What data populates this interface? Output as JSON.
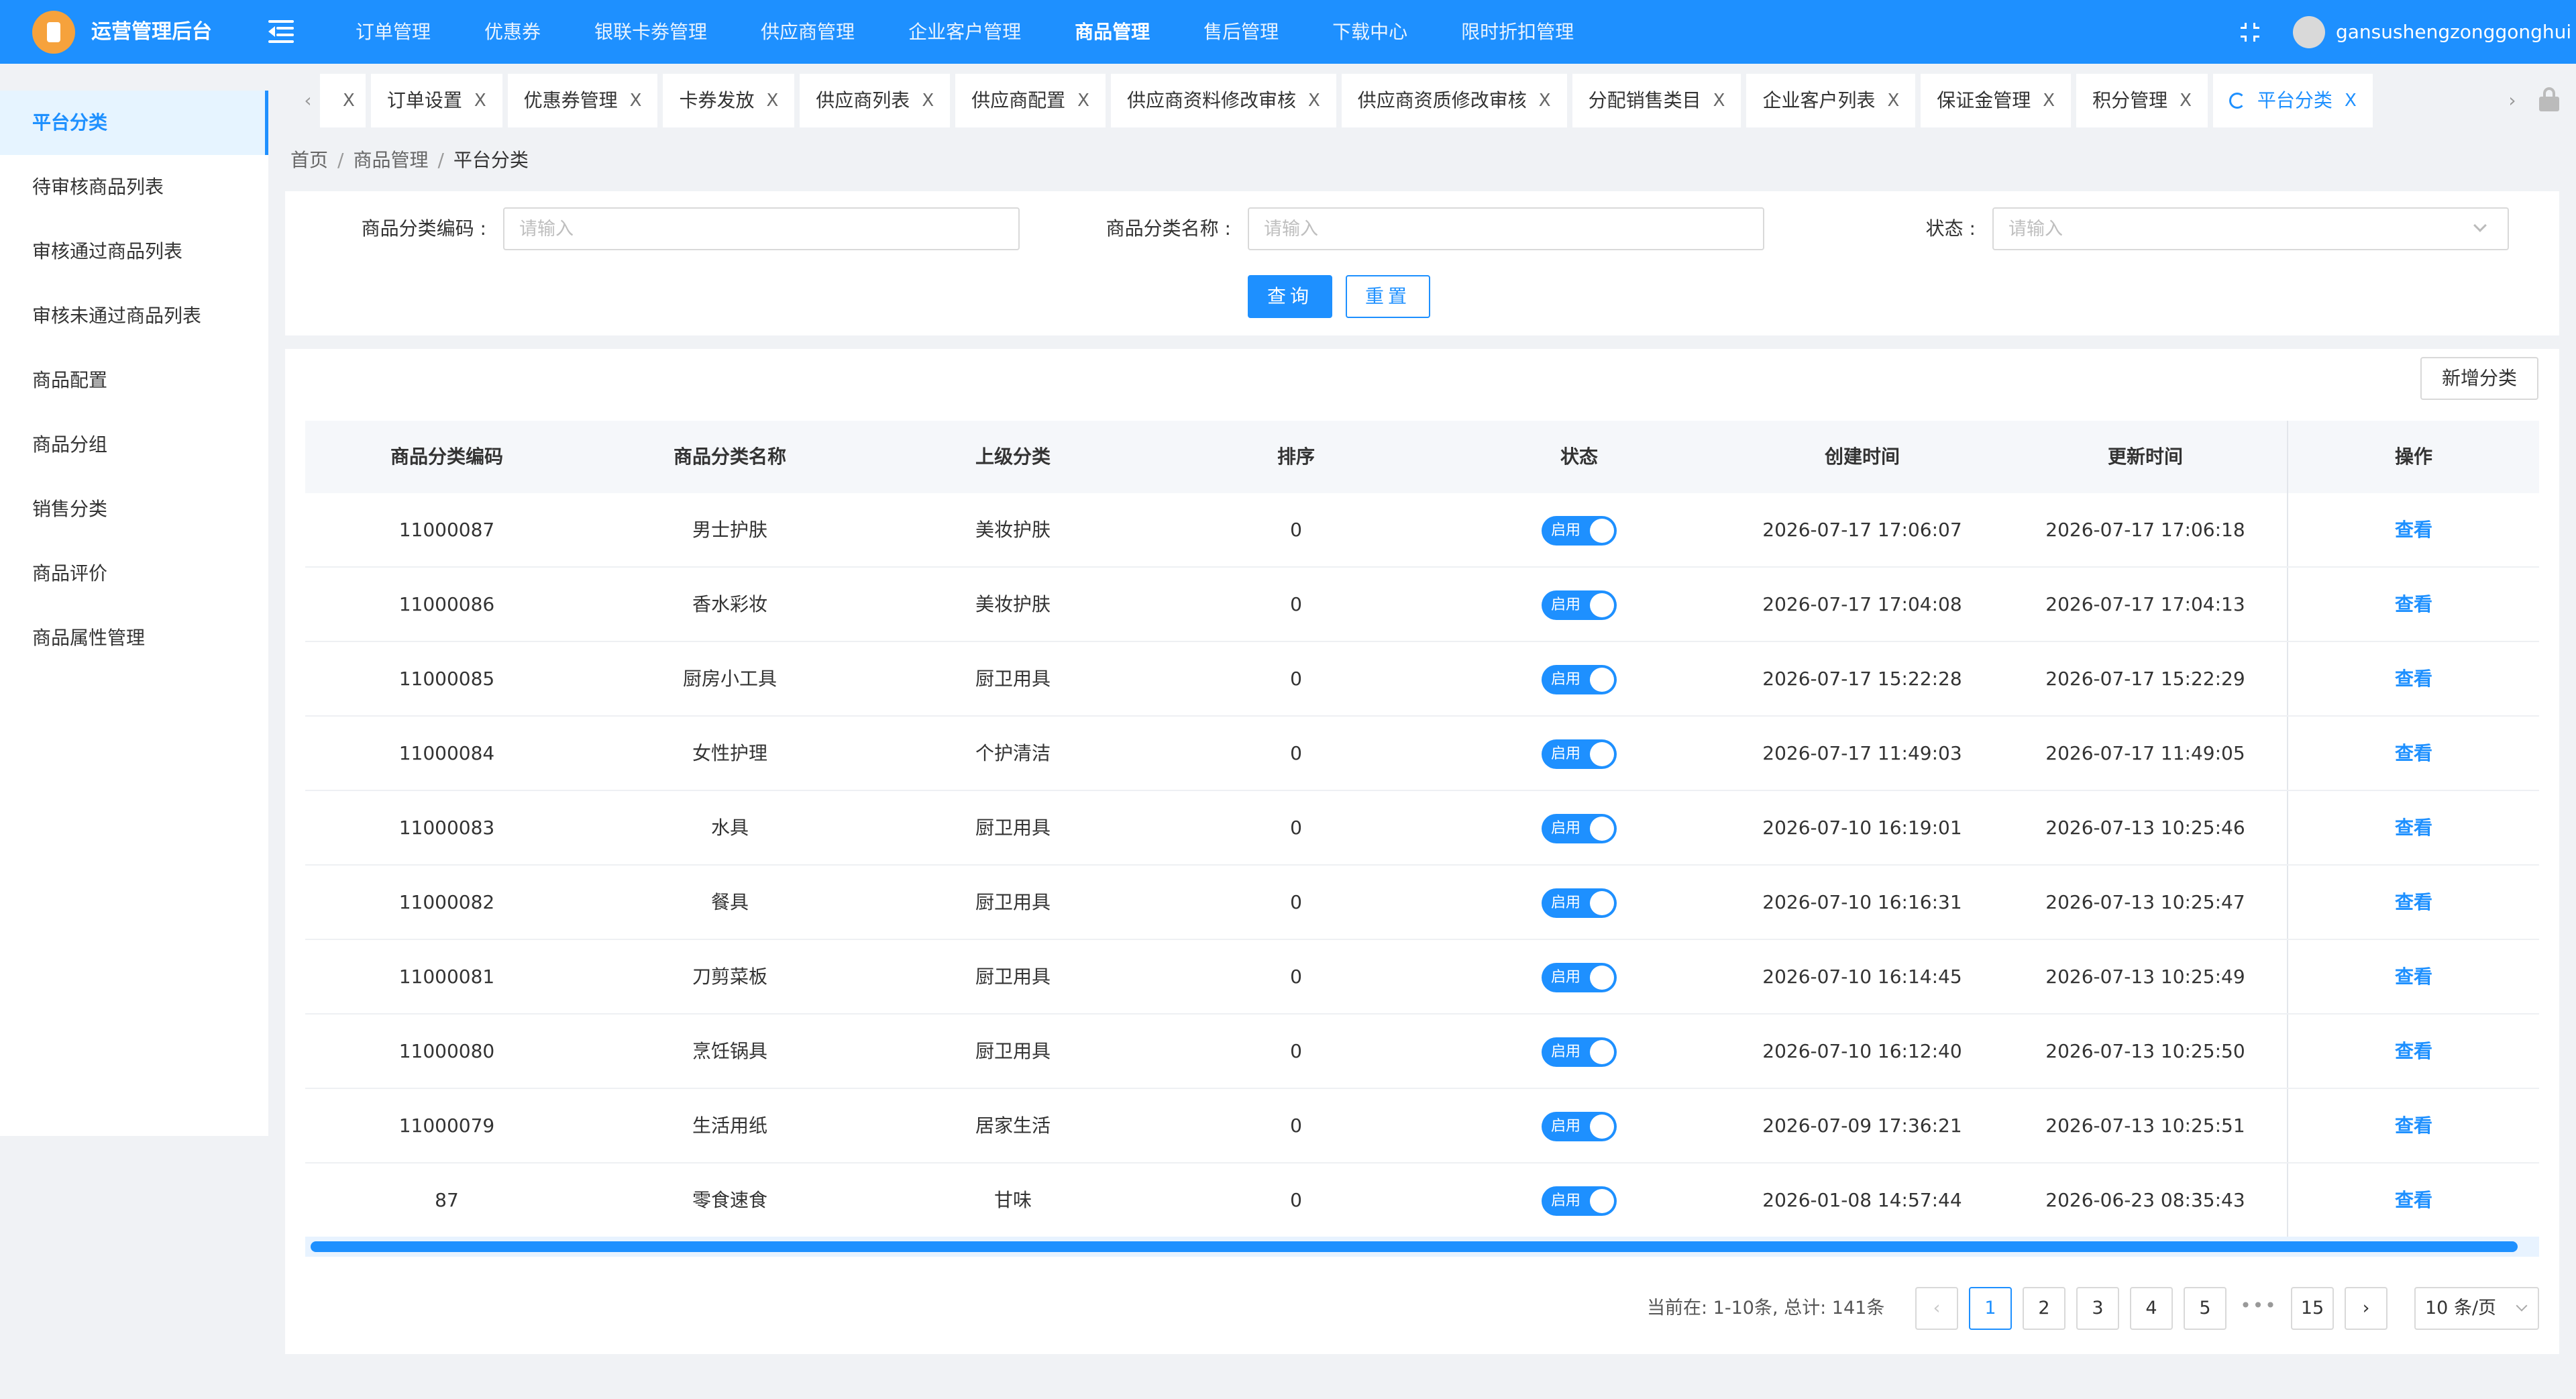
{
  "app": {
    "title": "运营管理后台",
    "username": "gansushengzonggonghui"
  },
  "top_nav": [
    "订单管理",
    "优惠券",
    "银联卡劵管理",
    "供应商管理",
    "企业客户管理",
    "商品管理",
    "售后管理",
    "下载中心",
    "限时折扣管理"
  ],
  "sidebar": [
    "平台分类",
    "待审核商品列表",
    "审核通过商品列表",
    "审核未通过商品列表",
    "商品配置",
    "商品分组",
    "销售分类",
    "商品评价",
    "商品属性管理"
  ],
  "tabs": [
    "订单设置",
    "优惠券管理",
    "卡券发放",
    "供应商列表",
    "供应商配置",
    "供应商资料修改审核",
    "供应商资质修改审核",
    "分配销售类目",
    "企业客户列表",
    "保证金管理",
    "积分管理",
    "平台分类"
  ],
  "tab_close": "X",
  "breadcrumb": [
    "首页",
    "商品管理",
    "平台分类"
  ],
  "breadcrumb_sep": "/",
  "search": {
    "code_label": "商品分类编码 :",
    "name_label": "商品分类名称 :",
    "status_label": "状态 :",
    "placeholder": "请输入",
    "query_button": "查询",
    "reset_button": "重置"
  },
  "add_button": "新增分类",
  "table": {
    "headers": [
      "商品分类编码",
      "商品分类名称",
      "上级分类",
      "排序",
      "状态",
      "创建时间",
      "更新时间",
      "操作"
    ],
    "rows": [
      {
        "code": "11000087",
        "name": "男士护肤",
        "parent": "美妆护肤",
        "sort": "0",
        "status": "启用",
        "created": "2026-07-17 17:06:07",
        "updated": "2026-07-17 17:06:18",
        "action": "查看"
      },
      {
        "code": "11000086",
        "name": "香水彩妆",
        "parent": "美妆护肤",
        "sort": "0",
        "status": "启用",
        "created": "2026-07-17 17:04:08",
        "updated": "2026-07-17 17:04:13",
        "action": "查看"
      },
      {
        "code": "11000085",
        "name": "厨房小工具",
        "parent": "厨卫用具",
        "sort": "0",
        "status": "启用",
        "created": "2026-07-17 15:22:28",
        "updated": "2026-07-17 15:22:29",
        "action": "查看"
      },
      {
        "code": "11000084",
        "name": "女性护理",
        "parent": "个护清洁",
        "sort": "0",
        "status": "启用",
        "created": "2026-07-17 11:49:03",
        "updated": "2026-07-17 11:49:05",
        "action": "查看"
      },
      {
        "code": "11000083",
        "name": "水具",
        "parent": "厨卫用具",
        "sort": "0",
        "status": "启用",
        "created": "2026-07-10 16:19:01",
        "updated": "2026-07-13 10:25:46",
        "action": "查看"
      },
      {
        "code": "11000082",
        "name": "餐具",
        "parent": "厨卫用具",
        "sort": "0",
        "status": "启用",
        "created": "2026-07-10 16:16:31",
        "updated": "2026-07-13 10:25:47",
        "action": "查看"
      },
      {
        "code": "11000081",
        "name": "刀剪菜板",
        "parent": "厨卫用具",
        "sort": "0",
        "status": "启用",
        "created": "2026-07-10 16:14:45",
        "updated": "2026-07-13 10:25:49",
        "action": "查看"
      },
      {
        "code": "11000080",
        "name": "烹饪锅具",
        "parent": "厨卫用具",
        "sort": "0",
        "status": "启用",
        "created": "2026-07-10 16:12:40",
        "updated": "2026-07-13 10:25:50",
        "action": "查看"
      },
      {
        "code": "11000079",
        "name": "生活用纸",
        "parent": "居家生活",
        "sort": "0",
        "status": "启用",
        "created": "2026-07-09 17:36:21",
        "updated": "2026-07-13 10:25:51",
        "action": "查看"
      },
      {
        "code": "87",
        "name": "零食速食",
        "parent": "甘味",
        "sort": "0",
        "status": "启用",
        "created": "2026-01-08 14:57:44",
        "updated": "2026-06-23 08:35:43",
        "action": "查看"
      }
    ]
  },
  "pagination": {
    "summary": "当前在: 1-10条,   总计: 141条",
    "pages": [
      "1",
      "2",
      "3",
      "4",
      "5"
    ],
    "ellipsis": "•••",
    "last_page": "15",
    "prev": "‹",
    "next": "›",
    "page_size": "10 条/页"
  },
  "colors": {
    "primary": "#1e90ff",
    "logo": "#f6a23c",
    "background": "#f0f2f5"
  },
  "icons": [
    "menu-toggle-icon",
    "fullscreen-icon",
    "refresh-icon",
    "lock-icon",
    "chevron-down-icon"
  ]
}
